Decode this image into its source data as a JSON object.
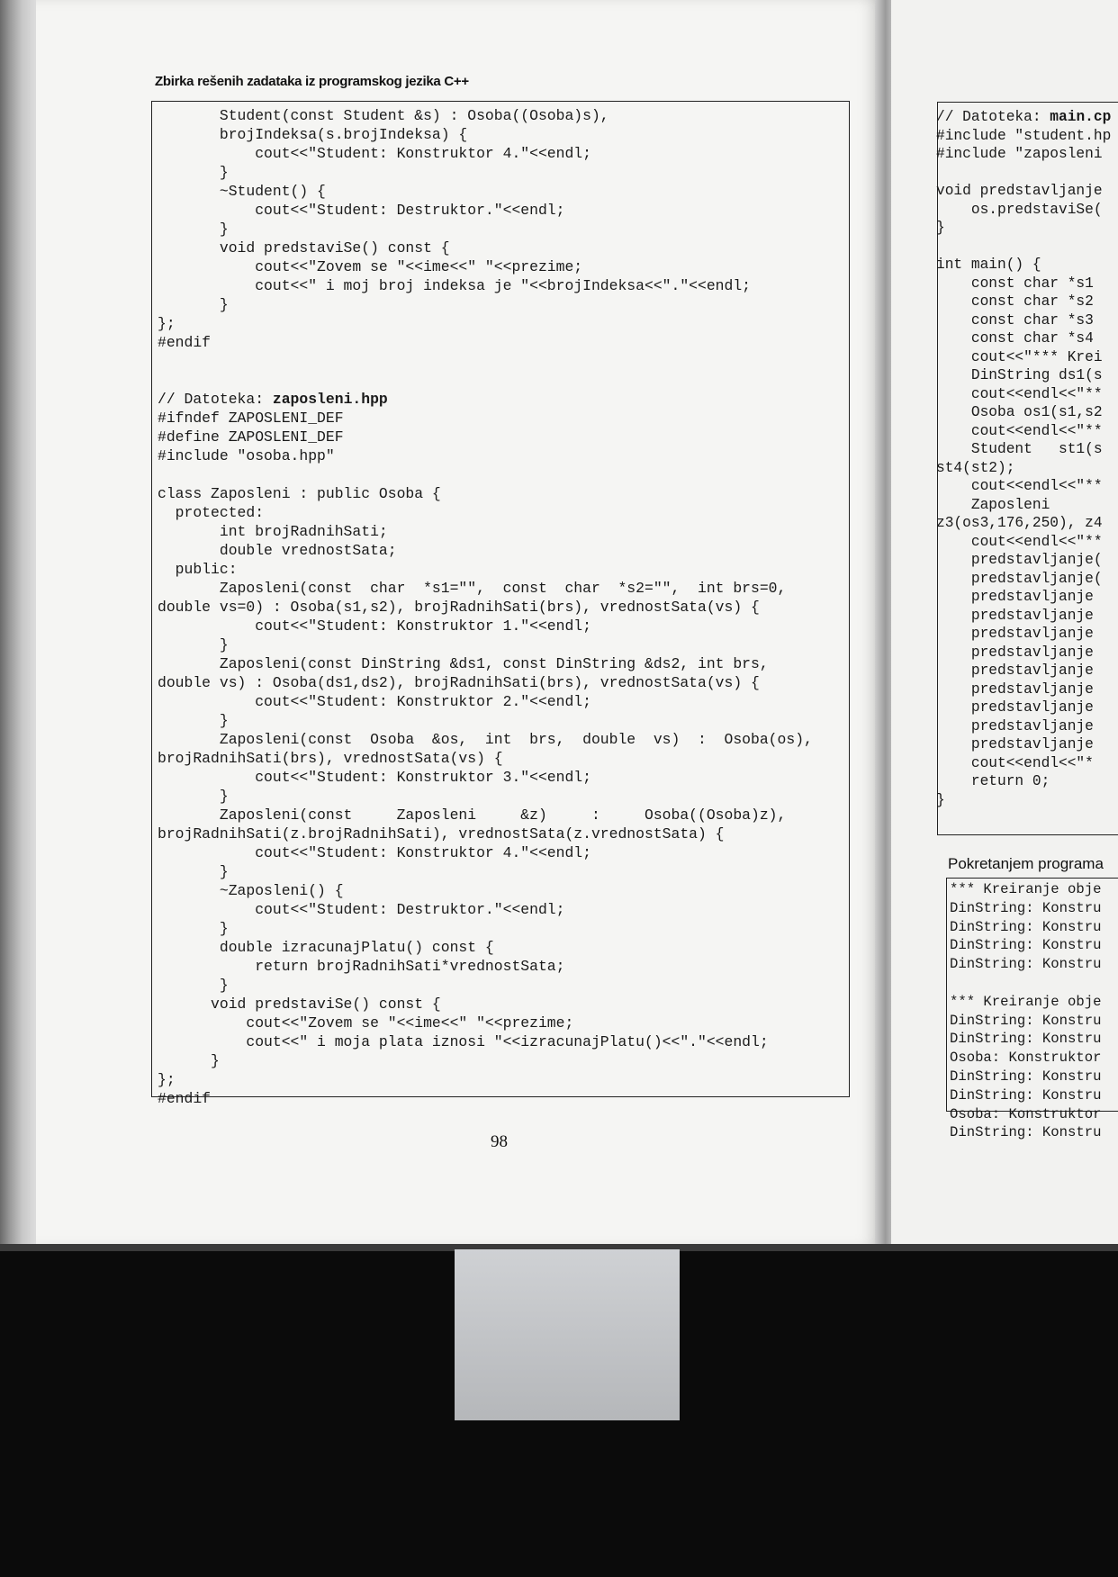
{
  "header": {
    "title": "Zbirka rešenih zadataka iz programskog jezika C++"
  },
  "left_code": [
    "       Student(const Student &s) : Osoba((Osoba)s),",
    "       brojIndeksa(s.brojIndeksa) {",
    "           cout<<\"Student: Konstruktor 4.\"<<endl;",
    "       }",
    "       ~Student() {",
    "           cout<<\"Student: Destruktor.\"<<endl;",
    "       }",
    "       void predstaviSe() const {",
    "           cout<<\"Zovem se \"<<ime<<\" \"<<prezime;",
    "           cout<<\" i moj broj indeksa je \"<<brojIndeksa<<\".\"<<endl;",
    "       }",
    "};",
    "#endif",
    "",
    "",
    "// Datoteka: zaposleni.hpp",
    "#ifndef ZAPOSLENI_DEF",
    "#define ZAPOSLENI_DEF",
    "#include \"osoba.hpp\"",
    "",
    "class Zaposleni : public Osoba {",
    "  protected:",
    "       int brojRadnihSati;",
    "       double vrednostSata;",
    "  public:",
    "       Zaposleni(const  char  *s1=\"\",  const  char  *s2=\"\",  int brs=0,",
    "double vs=0) : Osoba(s1,s2), brojRadnihSati(brs), vrednostSata(vs) {",
    "           cout<<\"Student: Konstruktor 1.\"<<endl;",
    "       }",
    "       Zaposleni(const DinString &ds1, const DinString &ds2, int brs,",
    "double vs) : Osoba(ds1,ds2), brojRadnihSati(brs), vrednostSata(vs) {",
    "           cout<<\"Student: Konstruktor 2.\"<<endl;",
    "       }",
    "       Zaposleni(const  Osoba  &os,  int  brs,  double  vs)  :  Osoba(os),",
    "brojRadnihSati(brs), vrednostSata(vs) {",
    "           cout<<\"Student: Konstruktor 3.\"<<endl;",
    "       }",
    "       Zaposleni(const     Zaposleni     &z)     :     Osoba((Osoba)z),",
    "brojRadnihSati(z.brojRadnihSati), vrednostSata(z.vrednostSata) {",
    "           cout<<\"Student: Konstruktor 4.\"<<endl;",
    "       }",
    "       ~Zaposleni() {",
    "           cout<<\"Student: Destruktor.\"<<endl;",
    "       }",
    "       double izracunajPlatu() const {",
    "           return brojRadnihSati*vrednostSata;",
    "       }",
    "      void predstaviSe() const {",
    "          cout<<\"Zovem se \"<<ime<<\" \"<<prezime;",
    "          cout<<\" i moja plata iznosi \"<<izracunajPlatu()<<\".\"<<endl;",
    "      }",
    "};",
    "#endif"
  ],
  "page_number": "98",
  "right_code": [
    "// Datoteka: main.cp",
    "#include \"student.hp",
    "#include \"zaposleni",
    "",
    "void predstavljanje",
    "    os.predstaviSe(",
    "}",
    "",
    "int main() {",
    "    const char *s1",
    "    const char *s2",
    "    const char *s3",
    "    const char *s4",
    "    cout<<\"*** Krei",
    "    DinString ds1(s",
    "    cout<<endl<<\"**",
    "    Osoba os1(s1,s2",
    "    cout<<endl<<\"**",
    "    Student   st1(s",
    "st4(st2);",
    "    cout<<endl<<\"**",
    "    Zaposleni",
    "z3(os3,176,250), z4",
    "    cout<<endl<<\"**",
    "    predstavljanje(",
    "    predstavljanje(",
    "    predstavljanje",
    "    predstavljanje",
    "    predstavljanje",
    "    predstavljanje",
    "    predstavljanje",
    "    predstavljanje",
    "    predstavljanje",
    "    predstavljanje",
    "    predstavljanje",
    "    cout<<endl<<\"*",
    "    return 0;",
    "}"
  ],
  "run_heading": "Pokretanjem programa",
  "output_lines": [
    "*** Kreiranje obje",
    "DinString: Konstru",
    "DinString: Konstru",
    "DinString: Konstru",
    "DinString: Konstru",
    "",
    "*** Kreiranje obje",
    "DinString: Konstru",
    "DinString: Konstru",
    "Osoba: Konstruktor",
    "DinString: Konstru",
    "DinString: Konstru",
    "Osoba: Konstruktor",
    "DinString: Konstru"
  ]
}
